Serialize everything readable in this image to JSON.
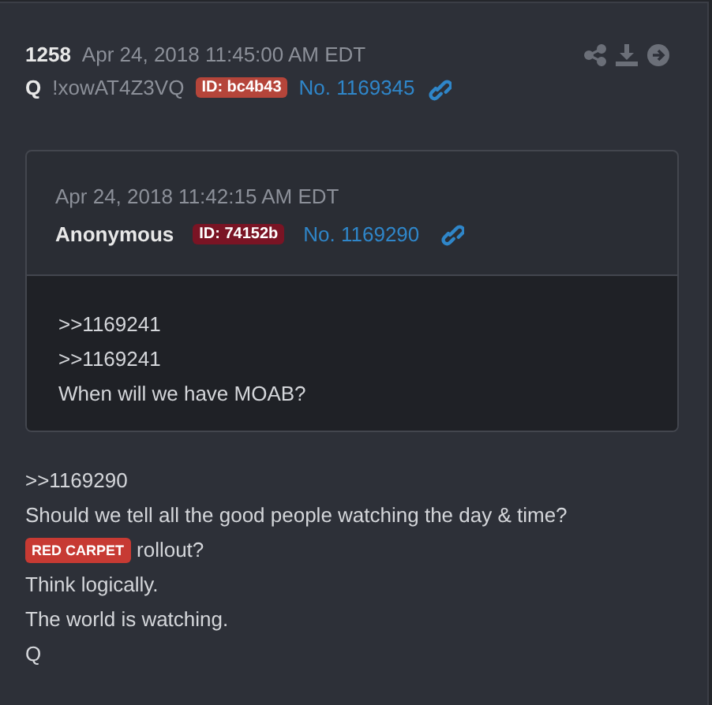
{
  "post": {
    "number": "1258",
    "date": "Apr 24, 2018 11:45:00 AM EDT",
    "name": "Q",
    "tripcode": "!xowAT4Z3VQ",
    "id": "ID: bc4b43",
    "color": "#b5453a",
    "post_no": "No. 1169345"
  },
  "quoted_post": {
    "date": "Apr 24, 2018 11:42:15 AM EDT",
    "name": "Anonymous",
    "id": "ID: 74152b",
    "color": "#7a1424",
    "post_no": "No. 1169290",
    "lines": [
      {
        "text": ">>1169241"
      },
      {
        "text": ">>1169241"
      },
      {
        "text": "When will we have MOAB?"
      }
    ]
  },
  "lines": [
    {
      "text": ">>1169290"
    },
    {
      "text": "Should we tell all the good people watching the day & time?"
    },
    {
      "tag": "RED CARPET",
      "text": "rollout?"
    },
    {
      "text": "Think logically."
    },
    {
      "text": "The world is watching."
    },
    {
      "text": "Q"
    }
  ]
}
